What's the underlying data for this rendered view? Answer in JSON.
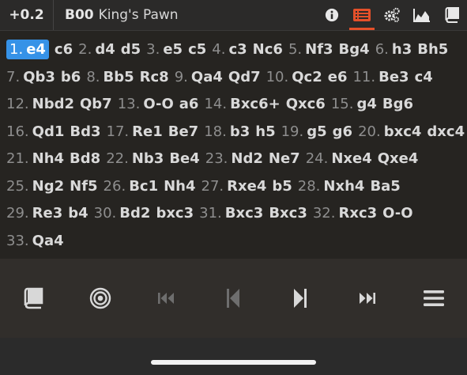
{
  "header": {
    "eval": "+0.2",
    "eco": "B00",
    "opening_name": "King's Pawn",
    "icons": [
      "info-icon",
      "move-list-icon",
      "settings-gears-icon",
      "chart-icon",
      "book-icon"
    ],
    "accent": "#e4502a"
  },
  "moves": {
    "current_color": "#3692e7",
    "list": [
      {
        "n": "1.",
        "w": "e4",
        "b": "c6"
      },
      {
        "n": "2.",
        "w": "d4",
        "b": "d5"
      },
      {
        "n": "3.",
        "w": "e5",
        "b": "c5"
      },
      {
        "n": "4.",
        "w": "c3",
        "b": "Nc6"
      },
      {
        "n": "5.",
        "w": "Nf3",
        "b": "Bg4"
      },
      {
        "n": "6.",
        "w": "h3",
        "b": "Bh5"
      },
      {
        "n": "7.",
        "w": "Qb3",
        "b": "b6"
      },
      {
        "n": "8.",
        "w": "Bb5",
        "b": "Rc8"
      },
      {
        "n": "9.",
        "w": "Qa4",
        "b": "Qd7"
      },
      {
        "n": "10.",
        "w": "Qc2",
        "b": "e6"
      },
      {
        "n": "11.",
        "w": "Be3",
        "b": "c4"
      },
      {
        "n": "12.",
        "w": "Nbd2",
        "b": "Qb7"
      },
      {
        "n": "13.",
        "w": "O-O",
        "b": "a6"
      },
      {
        "n": "14.",
        "w": "Bxc6+",
        "b": "Qxc6"
      },
      {
        "n": "15.",
        "w": "g4",
        "b": "Bg6"
      },
      {
        "n": "16.",
        "w": "Qd1",
        "b": "Bd3"
      },
      {
        "n": "17.",
        "w": "Re1",
        "b": "Be7"
      },
      {
        "n": "18.",
        "w": "b3",
        "b": "h5"
      },
      {
        "n": "19.",
        "w": "g5",
        "b": "g6"
      },
      {
        "n": "20.",
        "w": "bxc4",
        "b": "dxc4"
      },
      {
        "n": "21.",
        "w": "Nh4",
        "b": "Bd8"
      },
      {
        "n": "22.",
        "w": "Nb3",
        "b": "Be4"
      },
      {
        "n": "23.",
        "w": "Nd2",
        "b": "Ne7"
      },
      {
        "n": "24.",
        "w": "Nxe4",
        "b": "Qxe4"
      },
      {
        "n": "25.",
        "w": "Ng2",
        "b": "Nf5"
      },
      {
        "n": "26.",
        "w": "Bc1",
        "b": "Nh4"
      },
      {
        "n": "27.",
        "w": "Rxe4",
        "b": "b5"
      },
      {
        "n": "28.",
        "w": "Nxh4",
        "b": "Ba5"
      },
      {
        "n": "29.",
        "w": "Re3",
        "b": "b4"
      },
      {
        "n": "30.",
        "w": "Bd2",
        "b": "bxc3"
      },
      {
        "n": "31.",
        "w": "Bxc3",
        "b": "Bxc3"
      },
      {
        "n": "32.",
        "w": "Rxc3",
        "b": "O-O"
      },
      {
        "n": "33.",
        "w": "Qa4",
        "b": ""
      }
    ],
    "lines": [
      [
        0,
        5
      ],
      [
        6,
        10
      ],
      [
        11,
        14
      ],
      [
        15,
        19
      ],
      [
        20,
        23
      ],
      [
        24,
        27
      ],
      [
        28,
        31
      ],
      [
        32,
        32
      ]
    ]
  },
  "toolbar": {
    "icons": [
      "book-icon",
      "target-icon",
      "first-move-icon",
      "previous-move-icon",
      "next-move-icon",
      "last-move-icon",
      "menu-icon"
    ]
  }
}
